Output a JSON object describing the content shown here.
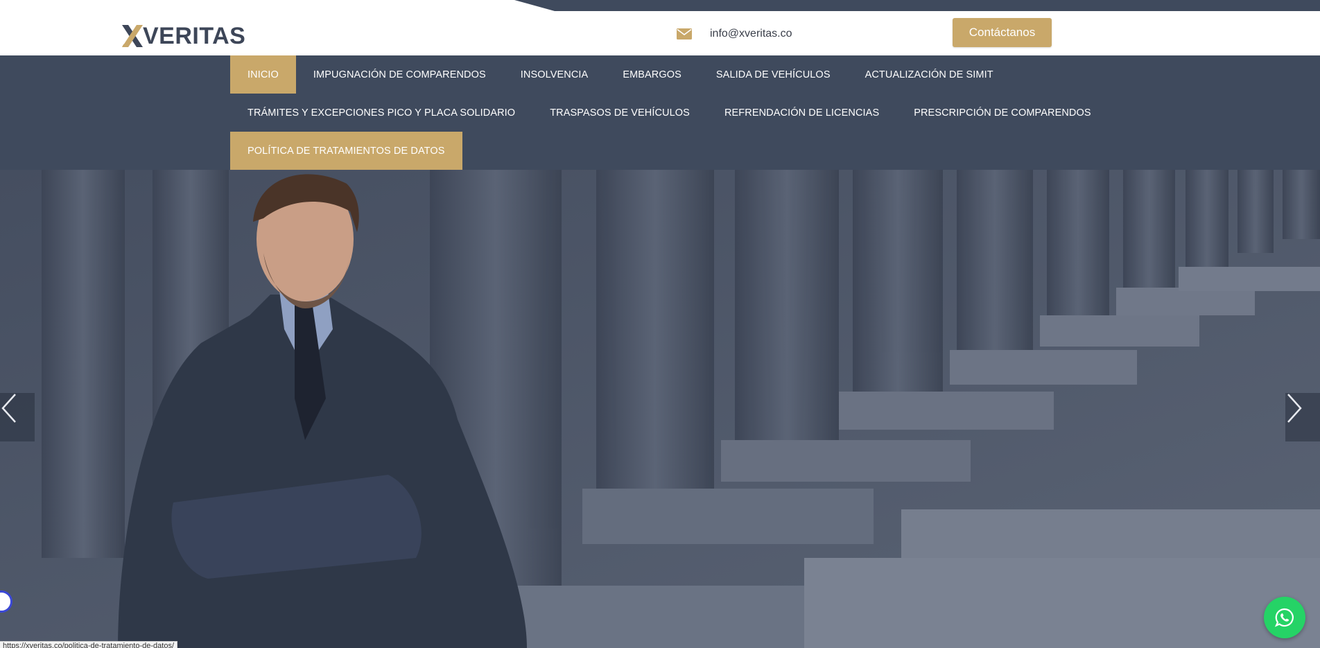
{
  "brand": {
    "name": "VERITAS",
    "mark": "X",
    "colors": {
      "gold": "#c9a86a",
      "navy": "#3f4a5d",
      "logo_text": "#3d4658"
    }
  },
  "header": {
    "email": "info@xveritas.co",
    "email_icon": "envelope-icon",
    "contact_label": "Contáctanos"
  },
  "nav": {
    "rows": [
      [
        {
          "label": "INICIO",
          "active": true
        },
        {
          "label": "IMPUGNACIÓN DE COMPARENDOS",
          "active": false
        },
        {
          "label": "INSOLVENCIA",
          "active": false
        },
        {
          "label": "EMBARGOS",
          "active": false
        },
        {
          "label": "SALIDA DE VEHÍCULOS",
          "active": false
        },
        {
          "label": "ACTUALIZACIÓN DE SIMIT",
          "active": false
        }
      ],
      [
        {
          "label": "TRÁMITES Y EXCEPCIONES PICO Y PLACA SOLIDARIO",
          "active": false
        },
        {
          "label": "TRASPASOS DE VEHÍCULOS",
          "active": false
        },
        {
          "label": "REFRENDACIÓN DE LICENCIAS",
          "active": false
        },
        {
          "label": "PRESCRIPCIÓN DE COMPARENDOS",
          "active": false
        }
      ],
      [
        {
          "label": "POLÍTICA DE TRATAMIENTOS DE DATOS",
          "active": true
        }
      ]
    ]
  },
  "hero": {
    "prev_icon": "chevron-left-icon",
    "next_icon": "chevron-right-icon"
  },
  "floating": {
    "whatsapp_icon": "whatsapp-icon",
    "accessibility_icon": "accessibility-icon"
  },
  "status_bar": {
    "url": "https://xveritas.co/politica-de-tratamiento-de-datos/"
  }
}
